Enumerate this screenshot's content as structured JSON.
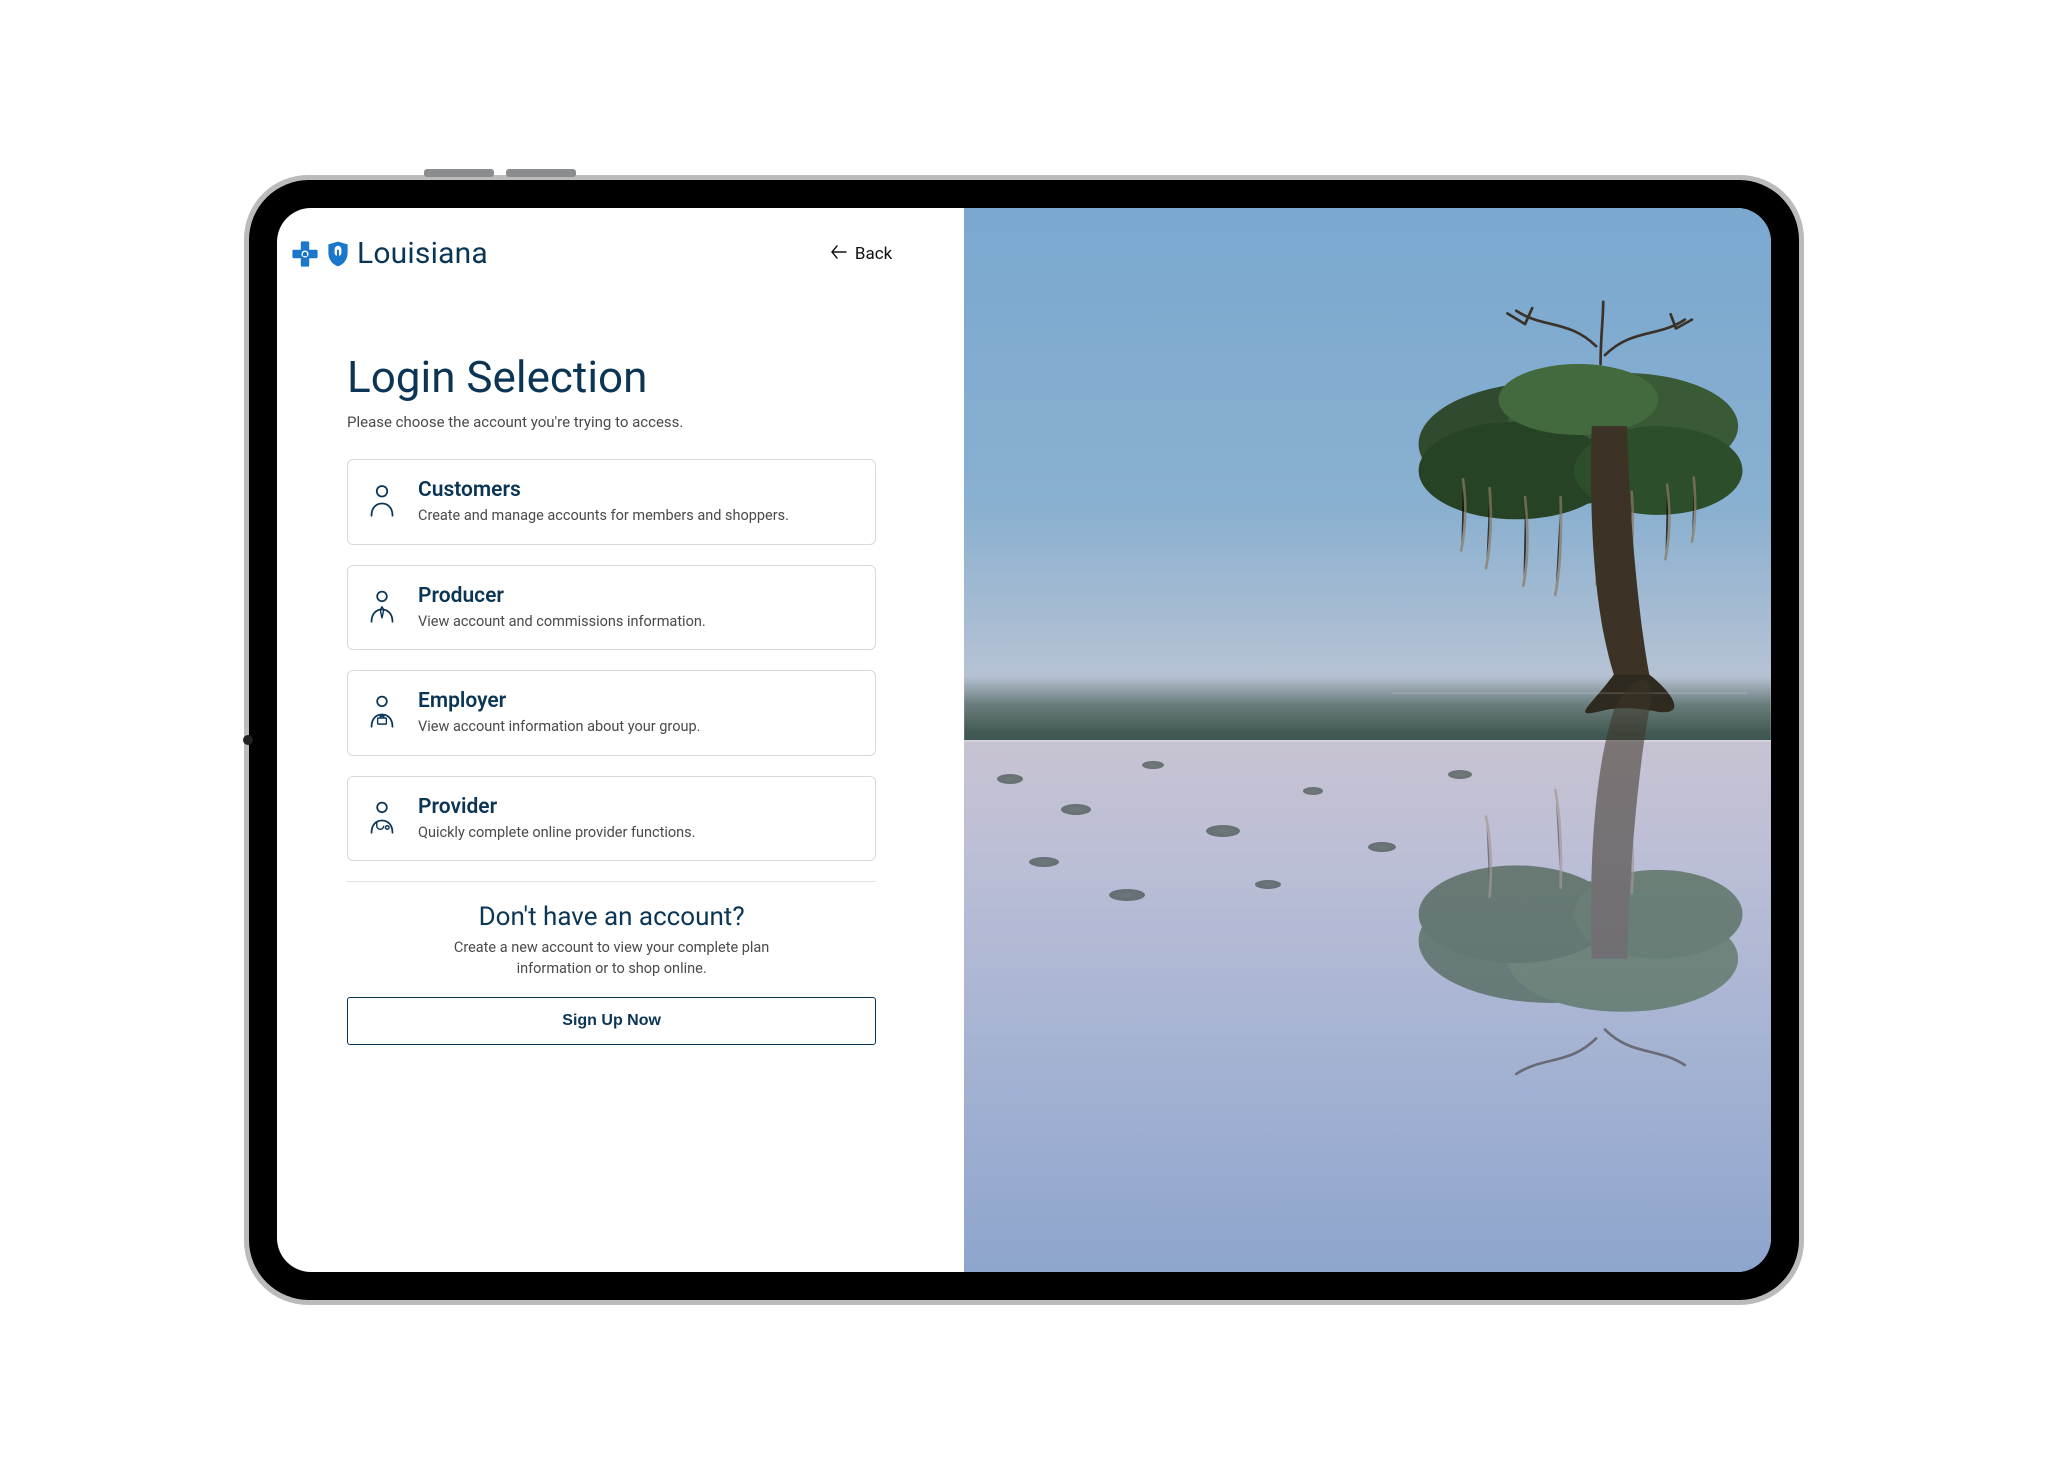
{
  "brand": {
    "name": "Louisiana"
  },
  "nav": {
    "back_label": "Back"
  },
  "page": {
    "title": "Login Selection",
    "subtitle": "Please choose the account you're trying to access."
  },
  "cards": [
    {
      "title": "Customers",
      "desc": "Create and manage accounts for members and shoppers."
    },
    {
      "title": "Producer",
      "desc": "View account and commissions information."
    },
    {
      "title": "Employer",
      "desc": "View account information about your group."
    },
    {
      "title": "Provider",
      "desc": "Quickly complete online provider functions."
    }
  ],
  "no_account": {
    "title": "Don't have an account?",
    "desc": "Create a new account to view your complete plan information or to shop online.",
    "cta": "Sign Up Now"
  },
  "colors": {
    "primary": "#0b3554",
    "accent": "#1a77c9"
  }
}
